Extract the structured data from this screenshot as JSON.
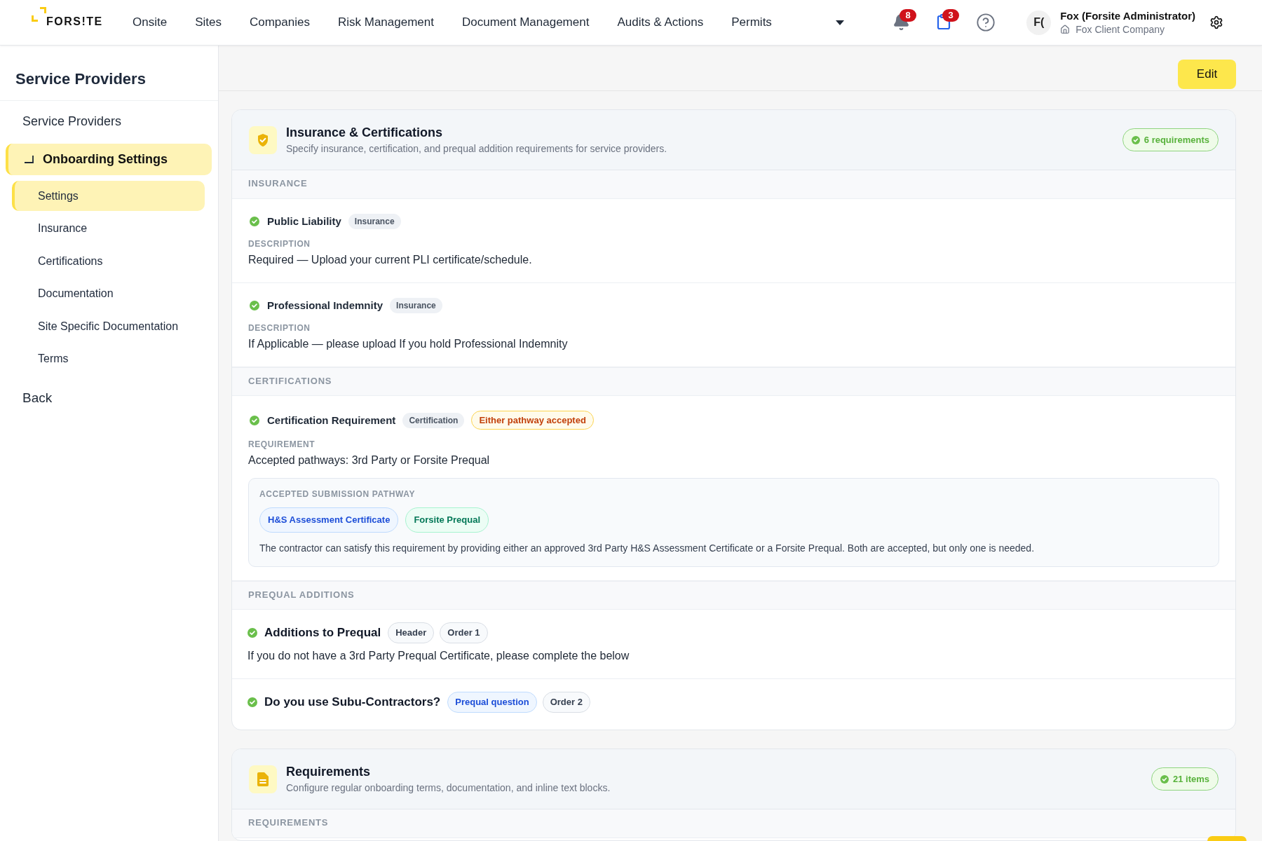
{
  "nav": {
    "logo": "FORS!TE",
    "items": [
      "Onsite",
      "Sites",
      "Companies",
      "Risk Management",
      "Document Management",
      "Audits & Actions",
      "Permits"
    ],
    "notifications": "8",
    "tasks": "3",
    "user": {
      "initials": "F(",
      "name": "Fox (Forsite Administrator)",
      "company": "Fox Client Company"
    }
  },
  "sidebar": {
    "title": "Service Providers",
    "items": [
      {
        "label": "Service Providers",
        "selected": false
      },
      {
        "label": "Onboarding Settings",
        "selected": true,
        "children": [
          {
            "label": "Settings",
            "selected": true
          },
          {
            "label": "Insurance",
            "selected": false
          },
          {
            "label": "Certifications",
            "selected": false
          },
          {
            "label": "Documentation",
            "selected": false
          },
          {
            "label": "Site Specific Documentation",
            "selected": false
          },
          {
            "label": "Terms",
            "selected": false
          }
        ]
      }
    ],
    "back": "Back"
  },
  "toolbar": {
    "edit_button": "Edit"
  },
  "cards": [
    {
      "kind": "certifications",
      "title": "Insurance & Certifications",
      "subtitle": "Specify insurance, certification, and prequal addition requirements for service providers.",
      "badge": "6 requirements",
      "sections": [
        {
          "heading": "INSURANCE",
          "items": [
            {
              "kind": "detail",
              "enabled": true,
              "title": "Public Liability",
              "tags": [
                {
                  "label": "Insurance",
                  "kind": "category"
                }
              ],
              "field": {
                "label": "DESCRIPTION",
                "value": "Required — Upload your current PLI certificate/schedule."
              }
            },
            {
              "kind": "detail",
              "enabled": true,
              "title": "Professional Indemnity",
              "tags": [
                {
                  "label": "Insurance",
                  "kind": "category"
                }
              ],
              "field": {
                "label": "DESCRIPTION",
                "value": "If Applicable — please upload If you hold Professional Indemnity"
              }
            }
          ]
        },
        {
          "heading": "CERTIFICATIONS",
          "items": [
            {
              "kind": "detail",
              "enabled": true,
              "title": "Certification Requirement",
              "tags": [
                {
                  "label": "Certification",
                  "kind": "category"
                },
                {
                  "label": "Either pathway accepted",
                  "kind": "notice"
                }
              ],
              "field": {
                "label": "REQUIREMENT",
                "value": "Accepted pathways: 3rd Party or Forsite Prequal"
              },
              "pathway": {
                "heading": "ACCEPTED SUBMISSION PATHWAY",
                "options": [
                  {
                    "label": "H&S Assessment Certificate",
                    "kind": "certificate"
                  },
                  {
                    "label": "Forsite Prequal",
                    "kind": "prequal"
                  }
                ],
                "note": "The contractor can satisfy this requirement by providing either an approved 3rd Party H&S Assessment Certificate or a Forsite Prequal. Both are accepted, but only one is needed."
              }
            }
          ]
        },
        {
          "heading": "PREQUAL ADDITIONS",
          "items": [
            {
              "kind": "prequal",
              "enabled": true,
              "title": "Additions to Prequal",
              "tags": [
                {
                  "label": "Header",
                  "kind": "meta"
                },
                {
                  "label": "Order 1",
                  "kind": "meta"
                }
              ],
              "text": "If you do not have a 3rd Party Prequal Certificate, please complete the below"
            },
            {
              "kind": "prequal",
              "enabled": true,
              "title": "Do you use Subu-Contractors?",
              "tags": [
                {
                  "label": "Prequal question",
                  "kind": "question"
                },
                {
                  "label": "Order 2",
                  "kind": "meta"
                }
              ]
            }
          ]
        }
      ]
    },
    {
      "kind": "requirements",
      "title": "Requirements",
      "subtitle": "Configure regular onboarding terms, documentation, and inline text blocks.",
      "badge": "21 items",
      "sections": [
        {
          "heading": "REQUIREMENTS"
        }
      ]
    }
  ]
}
